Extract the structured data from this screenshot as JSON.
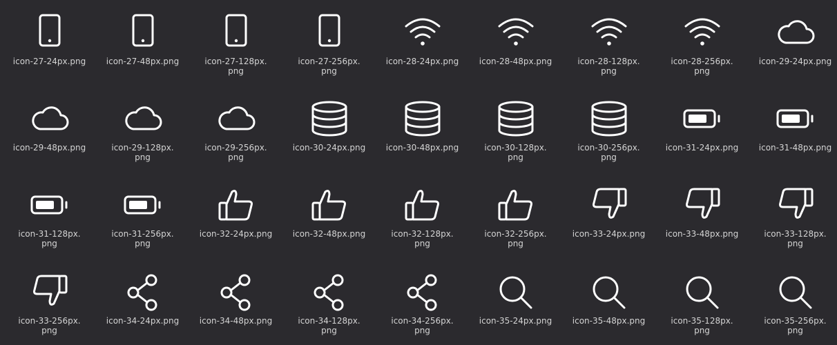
{
  "window": {
    "background": "#2b2a2e",
    "icon_color": "#ffffff",
    "label_color": "#d4d4d4"
  },
  "items": [
    {
      "label": "icon-27-24px.png",
      "icon": "tablet-icon"
    },
    {
      "label": "icon-27-48px.png",
      "icon": "tablet-icon"
    },
    {
      "label": "icon-27-128px.\npng",
      "icon": "tablet-icon"
    },
    {
      "label": "icon-27-256px.\npng",
      "icon": "tablet-icon"
    },
    {
      "label": "icon-28-24px.png",
      "icon": "wifi-icon"
    },
    {
      "label": "icon-28-48px.png",
      "icon": "wifi-icon"
    },
    {
      "label": "icon-28-128px.\npng",
      "icon": "wifi-icon"
    },
    {
      "label": "icon-28-256px.\npng",
      "icon": "wifi-icon"
    },
    {
      "label": "icon-29-24px.png",
      "icon": "cloud-icon"
    },
    {
      "label": "icon-29-48px.png",
      "icon": "cloud-icon"
    },
    {
      "label": "icon-29-128px.\npng",
      "icon": "cloud-icon"
    },
    {
      "label": "icon-29-256px.\npng",
      "icon": "cloud-icon"
    },
    {
      "label": "icon-30-24px.png",
      "icon": "database-icon"
    },
    {
      "label": "icon-30-48px.png",
      "icon": "database-icon"
    },
    {
      "label": "icon-30-128px.\npng",
      "icon": "database-icon"
    },
    {
      "label": "icon-30-256px.\npng",
      "icon": "database-icon"
    },
    {
      "label": "icon-31-24px.png",
      "icon": "battery-icon"
    },
    {
      "label": "icon-31-48px.png",
      "icon": "battery-icon"
    },
    {
      "label": "icon-31-128px.\npng",
      "icon": "battery-icon"
    },
    {
      "label": "icon-31-256px.\npng",
      "icon": "battery-icon"
    },
    {
      "label": "icon-32-24px.png",
      "icon": "thumbs-up-icon"
    },
    {
      "label": "icon-32-48px.png",
      "icon": "thumbs-up-icon"
    },
    {
      "label": "icon-32-128px.\npng",
      "icon": "thumbs-up-icon"
    },
    {
      "label": "icon-32-256px.\npng",
      "icon": "thumbs-up-icon"
    },
    {
      "label": "icon-33-24px.png",
      "icon": "thumbs-down-icon"
    },
    {
      "label": "icon-33-48px.png",
      "icon": "thumbs-down-icon"
    },
    {
      "label": "icon-33-128px.\npng",
      "icon": "thumbs-down-icon"
    },
    {
      "label": "icon-33-256px.\npng",
      "icon": "thumbs-down-icon"
    },
    {
      "label": "icon-34-24px.png",
      "icon": "share-icon"
    },
    {
      "label": "icon-34-48px.png",
      "icon": "share-icon"
    },
    {
      "label": "icon-34-128px.\npng",
      "icon": "share-icon"
    },
    {
      "label": "icon-34-256px.\npng",
      "icon": "share-icon"
    },
    {
      "label": "icon-35-24px.png",
      "icon": "search-icon"
    },
    {
      "label": "icon-35-48px.png",
      "icon": "search-icon"
    },
    {
      "label": "icon-35-128px.\npng",
      "icon": "search-icon"
    },
    {
      "label": "icon-35-256px.\npng",
      "icon": "search-icon"
    }
  ]
}
